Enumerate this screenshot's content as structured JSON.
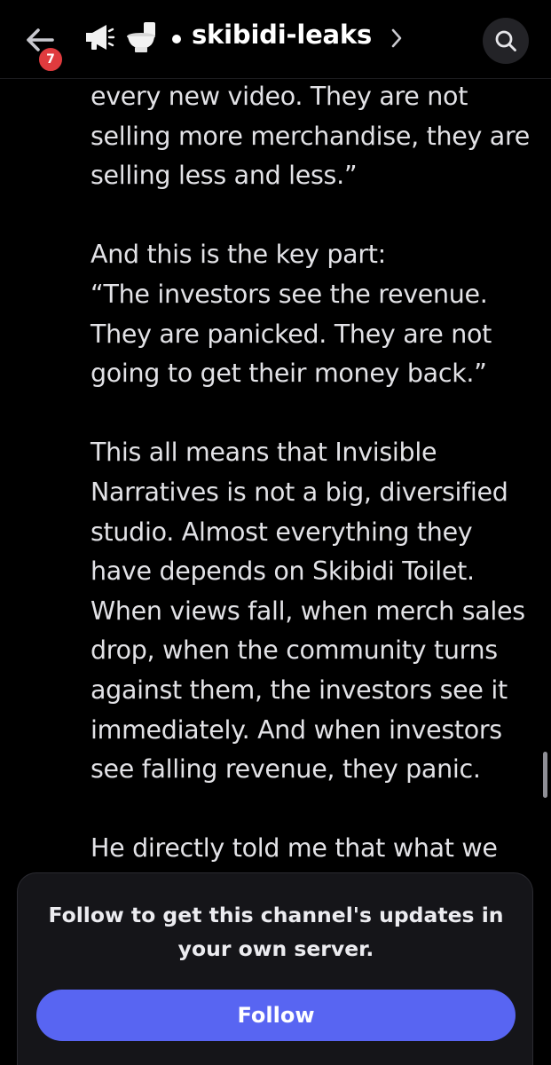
{
  "header": {
    "back_icon": "arrow-left-icon",
    "badge_count": "7",
    "channel_icons": [
      "megaphone-icon",
      "toilet-icon"
    ],
    "channel_name": "skibidi-leaks",
    "search_icon": "search-icon"
  },
  "message": {
    "paragraphs": [
      "every new video. They are not\nselling more merchandise, they are\nselling less and less.”",
      "And this is the key part:\n“The investors see the revenue.\nThey are panicked. They are not\ngoing to get their money back.”",
      "This all means that Invisible\nNarratives is not a big, diversified\nstudio. Almost everything they\nhave depends on Skibidi Toilet.\nWhen views fall, when merch sales\ndrop, when the community turns\nagainst them, the investors see it\nimmediately. And when investors\nsee falling revenue, they panic.",
      "He directly told me that what we"
    ]
  },
  "follow_card": {
    "prompt": "Follow to get this channel's updates in\nyour own server.",
    "button_label": "Follow"
  },
  "colors": {
    "background": "#000000",
    "accent": "#5865f2",
    "badge": "#e03b3e",
    "card": "#151519"
  }
}
